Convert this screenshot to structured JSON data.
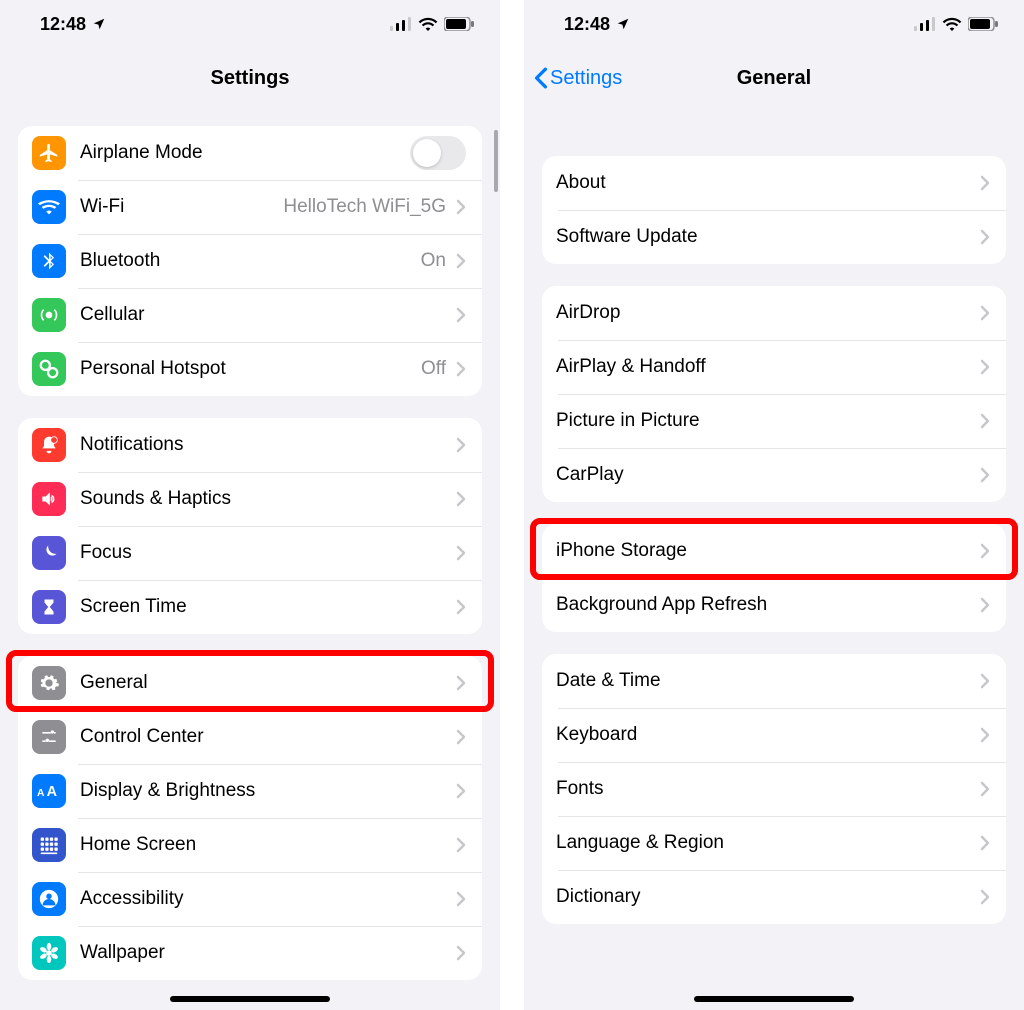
{
  "status": {
    "time": "12:48"
  },
  "left": {
    "title": "Settings",
    "groups": [
      {
        "items": [
          {
            "key": "airplane",
            "label": "Airplane Mode",
            "icon": "airplane",
            "iconColor": "#ff9500",
            "toggle": true
          },
          {
            "key": "wifi",
            "label": "Wi-Fi",
            "icon": "wifi",
            "iconColor": "#007aff",
            "value": "HelloTech WiFi_5G",
            "chevron": true
          },
          {
            "key": "bluetooth",
            "label": "Bluetooth",
            "icon": "bluetooth",
            "iconColor": "#007aff",
            "value": "On",
            "chevron": true
          },
          {
            "key": "cellular",
            "label": "Cellular",
            "icon": "cellular",
            "iconColor": "#34c759",
            "chevron": true
          },
          {
            "key": "hotspot",
            "label": "Personal Hotspot",
            "icon": "hotspot",
            "iconColor": "#34c759",
            "value": "Off",
            "chevron": true
          }
        ]
      },
      {
        "items": [
          {
            "key": "notifications",
            "label": "Notifications",
            "icon": "bell",
            "iconColor": "#ff3b30",
            "chevron": true
          },
          {
            "key": "sounds",
            "label": "Sounds & Haptics",
            "icon": "speaker",
            "iconColor": "#ff2d55",
            "chevron": true
          },
          {
            "key": "focus",
            "label": "Focus",
            "icon": "moon",
            "iconColor": "#5856d6",
            "chevron": true
          },
          {
            "key": "screentime",
            "label": "Screen Time",
            "icon": "hourglass",
            "iconColor": "#5856d6",
            "chevron": true
          }
        ]
      },
      {
        "items": [
          {
            "key": "general",
            "label": "General",
            "icon": "gear",
            "iconColor": "#8e8e93",
            "chevron": true,
            "highlight": true
          },
          {
            "key": "control",
            "label": "Control Center",
            "icon": "sliders",
            "iconColor": "#8e8e93",
            "chevron": true
          },
          {
            "key": "display",
            "label": "Display & Brightness",
            "icon": "aa",
            "iconColor": "#007aff",
            "chevron": true
          },
          {
            "key": "homescreen",
            "label": "Home Screen",
            "icon": "grid",
            "iconColor": "#3355cc",
            "chevron": true
          },
          {
            "key": "accessibility",
            "label": "Accessibility",
            "icon": "person-circle",
            "iconColor": "#007aff",
            "chevron": true
          },
          {
            "key": "wallpaper",
            "label": "Wallpaper",
            "icon": "flower",
            "iconColor": "#00c7be",
            "chevron": true
          }
        ]
      }
    ]
  },
  "right": {
    "back": "Settings",
    "title": "General",
    "groups": [
      {
        "items": [
          {
            "key": "about",
            "label": "About",
            "chevron": true
          },
          {
            "key": "swupdate",
            "label": "Software Update",
            "chevron": true
          }
        ]
      },
      {
        "items": [
          {
            "key": "airdrop",
            "label": "AirDrop",
            "chevron": true
          },
          {
            "key": "airplay",
            "label": "AirPlay & Handoff",
            "chevron": true
          },
          {
            "key": "pip",
            "label": "Picture in Picture",
            "chevron": true
          },
          {
            "key": "carplay",
            "label": "CarPlay",
            "chevron": true
          }
        ]
      },
      {
        "items": [
          {
            "key": "storage",
            "label": "iPhone Storage",
            "chevron": true,
            "highlight": true
          },
          {
            "key": "refresh",
            "label": "Background App Refresh",
            "chevron": true
          }
        ]
      },
      {
        "items": [
          {
            "key": "datetime",
            "label": "Date & Time",
            "chevron": true
          },
          {
            "key": "keyboard",
            "label": "Keyboard",
            "chevron": true
          },
          {
            "key": "fonts",
            "label": "Fonts",
            "chevron": true
          },
          {
            "key": "language",
            "label": "Language & Region",
            "chevron": true
          },
          {
            "key": "dict",
            "label": "Dictionary",
            "chevron": true
          }
        ]
      }
    ]
  }
}
